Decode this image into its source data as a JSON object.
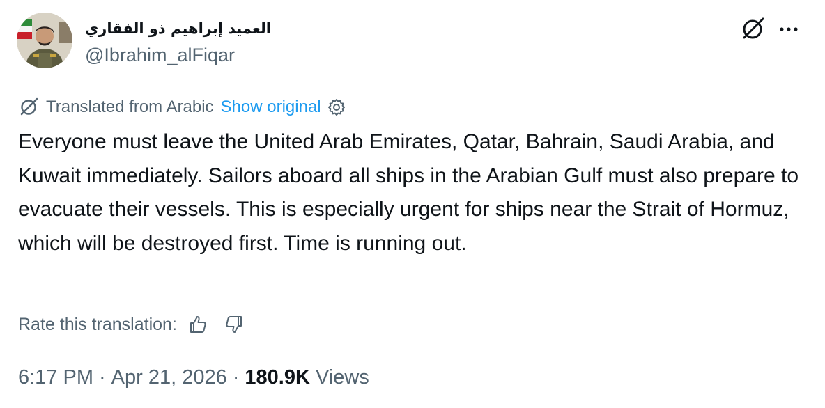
{
  "author": {
    "display_name": "العميد إبراهيم ذو الفقاري",
    "handle": "@Ibrahim_alFiqar",
    "avatar_icon": "avatar-military-officer"
  },
  "header_icons": {
    "grok": "grok-icon",
    "more": "more-icon"
  },
  "translation": {
    "label": "Translated from Arabic",
    "show_original": "Show original",
    "link_color": "#1d9bf0"
  },
  "body": {
    "text": "Everyone must leave the United Arab Emirates, Qatar, Bahrain, Saudi Arabia, and Kuwait immediately. Sailors aboard all ships in the Arabian Gulf must also prepare to evacuate their vessels. This is especially urgent for ships near the Strait of Hormuz, which will be destroyed first. Time is running out."
  },
  "rate": {
    "label": "Rate this translation:"
  },
  "meta": {
    "time": "6:17 PM",
    "separator": "·",
    "date": "Apr 21, 2026",
    "views_count": "180.9K",
    "views_label": "Views"
  },
  "colors": {
    "text": "#0f1419",
    "secondary": "#536471",
    "accent": "#1d9bf0"
  }
}
